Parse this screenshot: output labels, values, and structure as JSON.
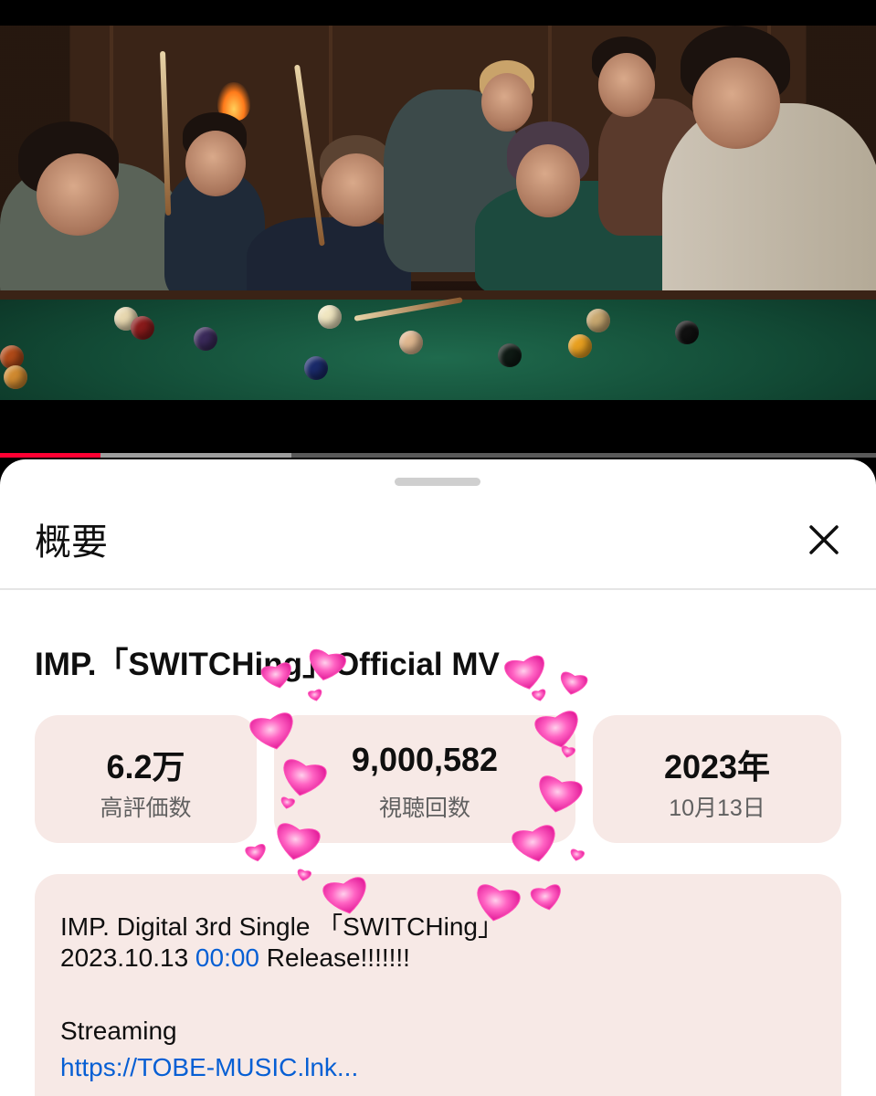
{
  "player": {
    "progress_played_fraction": 0.115,
    "progress_loaded_fraction": 0.333
  },
  "sheet": {
    "title": "概要",
    "close_icon": "close-icon"
  },
  "video": {
    "title": "IMP.「SWITCHing」Official MV"
  },
  "stats": [
    {
      "value": "6.2万",
      "label": "高評価数"
    },
    {
      "value": "9,000,582",
      "label": "視聴回数"
    },
    {
      "value": "2023年",
      "label": "10月13日"
    }
  ],
  "description": {
    "line1": "IMP. Digital 3rd Single 「SWITCHing」",
    "line2_date": "2023.10.13 ",
    "line2_time": "00:00",
    "line2_rest": " Release!!!!!!!",
    "line3": "Streaming",
    "line4_link": "https://TOBE-MUSIC.lnk..."
  },
  "colors": {
    "accent_red": "#ff0033",
    "link_blue": "#065fd4",
    "card_bg": "#f7e9e6",
    "heart_pink": "#ff4fb8"
  }
}
